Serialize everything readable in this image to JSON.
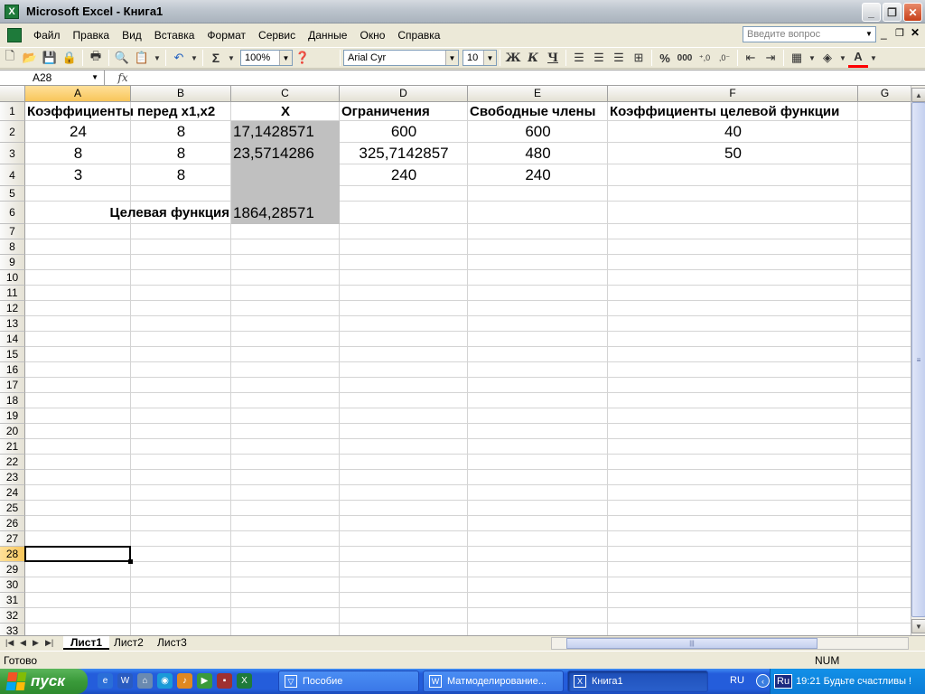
{
  "window": {
    "title": "Microsoft Excel - Книга1",
    "app_icon": "excel-icon"
  },
  "menu": {
    "items": [
      "Файл",
      "Правка",
      "Вид",
      "Вставка",
      "Формат",
      "Сервис",
      "Данные",
      "Окно",
      "Справка"
    ],
    "ask_placeholder": "Введите вопрос"
  },
  "toolbar": {
    "zoom": "100%",
    "font_name": "Arial Cyr",
    "font_size": "10",
    "bold_label": "Ж",
    "italic_label": "К",
    "underline_label": "Ч",
    "percent_label": "%",
    "thousands_label": "000",
    "sum_label": "Σ",
    "font_color": "#ff0000"
  },
  "formula_bar": {
    "cell_ref": "A28",
    "fx_label": "fx",
    "content": ""
  },
  "grid": {
    "columns": [
      "A",
      "B",
      "C",
      "D",
      "E",
      "F",
      "G"
    ],
    "selected_column": "A",
    "selected_row": "28",
    "rows": [
      "1",
      "2",
      "3",
      "4",
      "5",
      "6",
      "7",
      "8",
      "9",
      "10",
      "11",
      "12",
      "13",
      "14",
      "15",
      "16",
      "17",
      "18",
      "19",
      "20",
      "21",
      "22",
      "23",
      "24",
      "25",
      "26",
      "27",
      "28",
      "29",
      "30",
      "31",
      "32",
      "33"
    ],
    "cells": {
      "A1": "Коэффициенты перед x1,x2",
      "C1": "X",
      "D1": "Ограничения",
      "E1": "Свободные члены",
      "F1": "Коэффициенты целевой функции",
      "A2": "24",
      "B2": "8",
      "C2": "17,1428571",
      "D2": "600",
      "E2": "600",
      "F2": "40",
      "A3": "8",
      "B3": "8",
      "C3": "23,5714286",
      "D3": "325,7142857",
      "E3": "480",
      "F3": "50",
      "A4": "3",
      "B4": "8",
      "D4": "240",
      "E4": "240",
      "B6": "Целевая функция",
      "C6": "1864,28571"
    },
    "shaded_color": "#c0c0c0"
  },
  "sheets": {
    "tabs": [
      "Лист1",
      "Лист2",
      "Лист3"
    ],
    "active": "Лист1"
  },
  "status": {
    "text": "Готово",
    "num": "NUM"
  },
  "taskbar": {
    "start_label": "пуск",
    "tasks": [
      "Пособие",
      "Матмоделирование...",
      "Книга1"
    ],
    "active_task": "Книга1",
    "lang": "RU",
    "lang_badge": "Ru",
    "clock_text": "19:21 Будьте счастливы !"
  }
}
